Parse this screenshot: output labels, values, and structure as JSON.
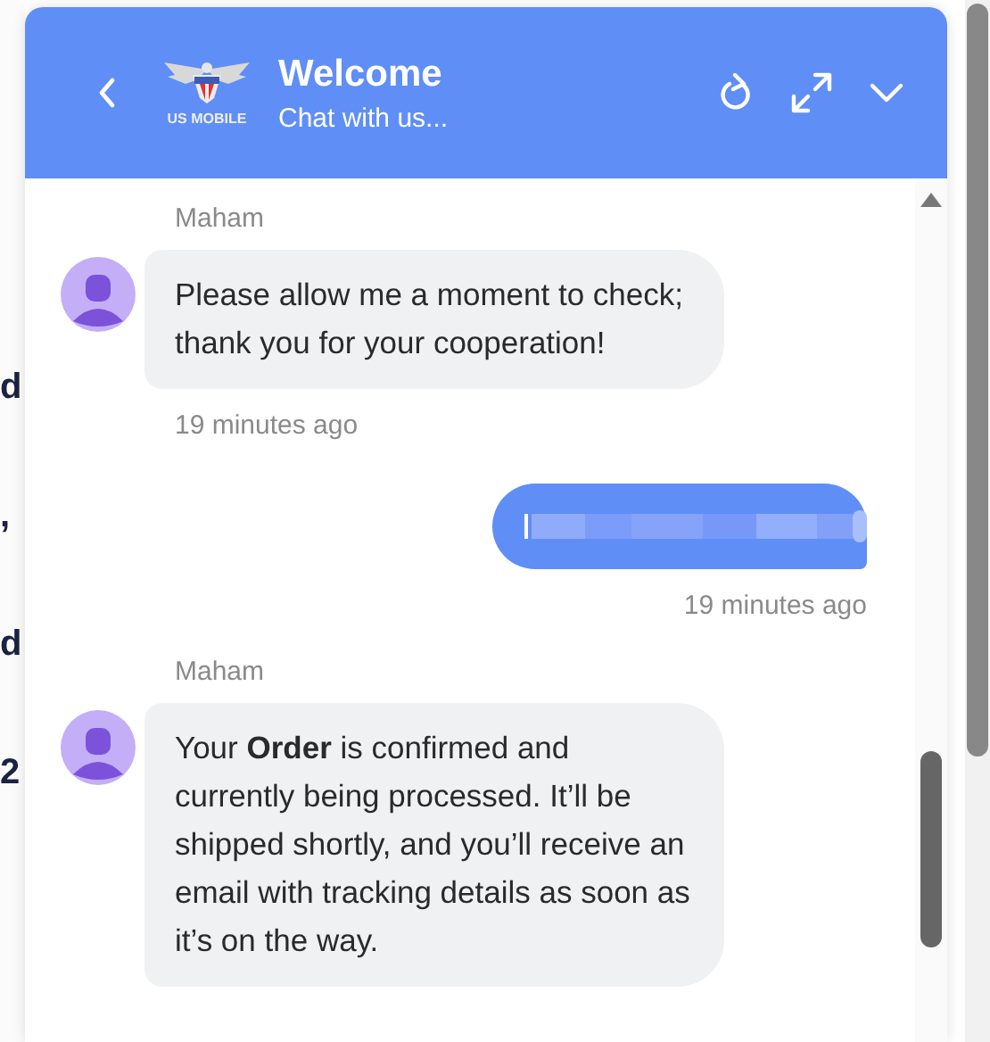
{
  "background_fragments": [
    "d",
    ",",
    "d",
    "2"
  ],
  "header": {
    "title": "Welcome",
    "subtitle": "Chat with us...",
    "logo_text": "US MOBILE"
  },
  "messages": [
    {
      "kind": "agent",
      "sender": "Maham",
      "text": "Please allow me a moment to check; thank you for your cooperation!",
      "time": "19 minutes ago"
    },
    {
      "kind": "user_redacted",
      "time": "19 minutes ago"
    },
    {
      "kind": "agent",
      "sender": "Maham",
      "text": "Your **Order** is confirmed and currently being processed. It’ll be shipped shortly, and you’ll receive an email with tracking details as soon as it’s on the way."
    }
  ]
}
